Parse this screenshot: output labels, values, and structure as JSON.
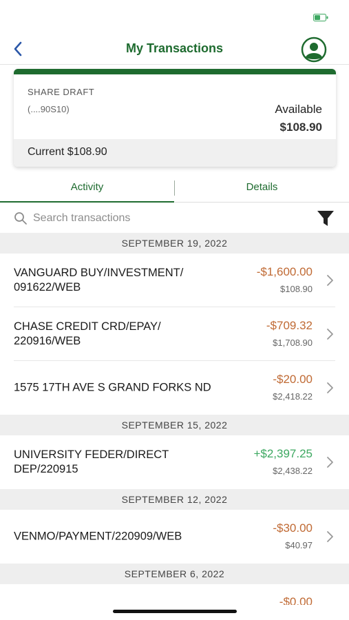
{
  "header": {
    "title": "My Transactions",
    "back_icon": "chevron-left-icon",
    "profile_icon": "user-circle-icon",
    "accent_color": "#1e6b2f"
  },
  "account": {
    "type": "SHARE DRAFT",
    "number": "(....90S10)",
    "available_label": "Available",
    "available_amount": "$108.90",
    "current": "Current $108.90"
  },
  "tabs": [
    {
      "label": "Activity",
      "active": true
    },
    {
      "label": "Details",
      "active": false
    }
  ],
  "search": {
    "placeholder": "Search transactions",
    "value": "",
    "filter_icon": "filter-icon"
  },
  "groups": [
    {
      "date": "SEPTEMBER 19, 2022",
      "transactions": [
        {
          "description": "VANGUARD BUY/INVESTMENT/ 091622/WEB",
          "amount": "-$1,600.00",
          "balance": "$108.90",
          "direction": "debit"
        },
        {
          "description": "CHASE CREDIT CRD/EPAY/ 220916/WEB",
          "amount": "-$709.32",
          "balance": "$1,708.90",
          "direction": "debit"
        },
        {
          "description": "1575 17TH AVE S GRAND FORKS ND",
          "amount": "-$20.00",
          "balance": "$2,418.22",
          "direction": "debit"
        }
      ]
    },
    {
      "date": "SEPTEMBER 15, 2022",
      "transactions": [
        {
          "description": "UNIVERSITY FEDER/DIRECT DEP/220915",
          "amount": "+$2,397.25",
          "balance": "$2,438.22",
          "direction": "credit"
        }
      ]
    },
    {
      "date": "SEPTEMBER 12, 2022",
      "transactions": [
        {
          "description": "VENMO/PAYMENT/220909/WEB",
          "amount": "-$30.00",
          "balance": "$40.97",
          "direction": "debit"
        }
      ]
    },
    {
      "date": "SEPTEMBER 6, 2022",
      "partial_amount": "-$0.00"
    }
  ]
}
